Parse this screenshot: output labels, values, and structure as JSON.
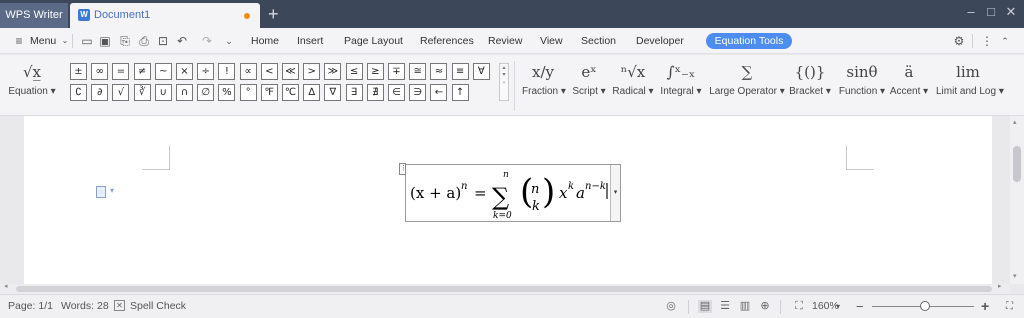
{
  "window": {
    "app_name": "WPS Writer",
    "document_tab": "Document1",
    "doc_icon_glyph": "W",
    "new_tab_glyph": "+",
    "minimize_glyph": "–",
    "maximize_glyph": "□",
    "close_glyph": "✕"
  },
  "menubar": {
    "menu_label": "Menu",
    "tabs": [
      "Home",
      "Insert",
      "Page Layout",
      "References",
      "Review",
      "View",
      "Section",
      "Developer"
    ],
    "active_tab": "Equation Tools",
    "toolbar_icons": [
      "open-icon",
      "save-icon",
      "export-pdf-icon",
      "print-icon",
      "preview-icon",
      "undo-icon",
      "redo-icon",
      "more-icon"
    ]
  },
  "ribbon": {
    "equation_label": "Equation",
    "symbols_row1": [
      "±",
      "∞",
      "=",
      "≠",
      "~",
      "×",
      "÷",
      "!",
      "∝",
      "<",
      "≪",
      ">",
      "≫",
      "≤",
      "≥",
      "∓",
      "≅",
      "≈",
      "≡",
      "∀"
    ],
    "symbols_row2": [
      "∁",
      "∂",
      "√",
      "∛",
      "∪",
      "∩",
      "∅",
      "%",
      "°",
      "℉",
      "℃",
      "∆",
      "∇",
      "∃",
      "∄",
      "∈",
      "∋",
      "←",
      "↑"
    ],
    "groups": [
      {
        "name": "fraction",
        "label": "Fraction",
        "glyph": "x/y"
      },
      {
        "name": "script",
        "label": "Script",
        "glyph": "eˣ"
      },
      {
        "name": "radical",
        "label": "Radical",
        "glyph": "ⁿ√x"
      },
      {
        "name": "integral",
        "label": "Integral",
        "glyph": "∫ˣ₋ₓ"
      },
      {
        "name": "large-operator",
        "label": "Large Operator",
        "glyph": "∑"
      },
      {
        "name": "bracket",
        "label": "Bracket",
        "glyph": "{()}"
      },
      {
        "name": "function",
        "label": "Function",
        "glyph": "sinθ"
      },
      {
        "name": "accent",
        "label": "Accent",
        "glyph": "ä"
      },
      {
        "name": "limit-and-log",
        "label": "Limit and Log",
        "glyph": "lim"
      }
    ]
  },
  "document": {
    "equation_parts": {
      "lhs": "(x + a)",
      "lhs_exp": "n",
      "equals": "=",
      "sum_top": "n",
      "sum_symbol": "∑",
      "sum_bottom": "k=0",
      "binom_top": "n",
      "binom_bottom": "k",
      "x": "x",
      "x_exp": "k",
      "a": "a",
      "a_exp": "n−k"
    }
  },
  "statusbar": {
    "page": "Page: 1/1",
    "words": "Words: 28",
    "spell_check": "Spell Check",
    "zoom": "160%",
    "zoom_minus": "−",
    "zoom_plus": "+",
    "zoom_level": 0.52
  }
}
